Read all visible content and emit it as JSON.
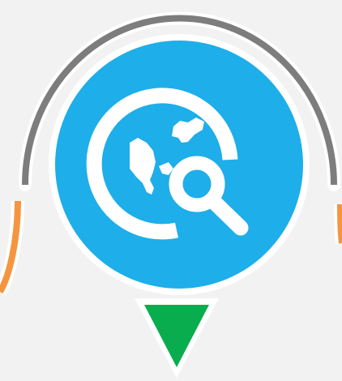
{
  "icon": {
    "name": "globe-search-icon",
    "circle_color": "#1eaee9",
    "glyph_color": "#ffffff"
  },
  "decorations": {
    "gray_arc_color": "#7d7d7d",
    "orange_arc_color": "#f5953f",
    "arrow_color": "#0aad4d",
    "outline_color": "#ffffff"
  }
}
